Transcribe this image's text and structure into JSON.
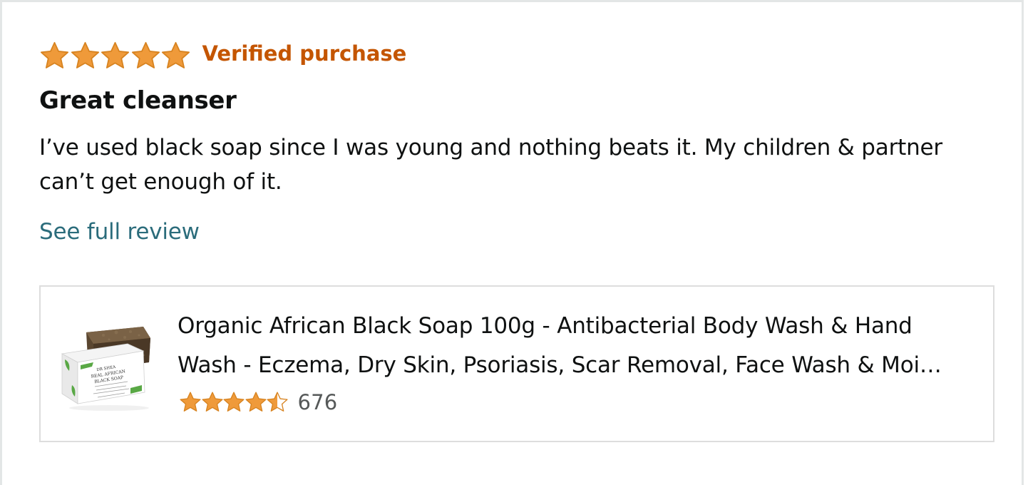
{
  "review": {
    "star_rating": 5,
    "max_stars": 5,
    "verified_label": "Verified purchase",
    "title": "Great cleanser",
    "body": "I’ve used black soap since I was young and nothing beats it. My children & partner can’t get enough of it.",
    "see_full_label": "See full review"
  },
  "product": {
    "title": "Organic African Black Soap 100g - Antibacterial Body Wash & Hand Wash - Eczema, Dry Skin, Psoriasis, Scar Removal, Face Wash & Moi…",
    "star_rating": 4.5,
    "max_stars": 5,
    "review_count": "676",
    "image_name": "black-soap-product-image",
    "box_label_lines": [
      "DR SHEA",
      "REAL AFRICAN",
      "BLACK SOAP"
    ]
  },
  "colors": {
    "star_fill": "#ef9a3a",
    "star_stroke": "#d78320",
    "verified": "#c45500",
    "link": "#2b6c7b",
    "text": "#0f1111",
    "muted": "#565959",
    "border": "#dddddd",
    "brand_green": "#59a845"
  },
  "icons": {
    "full_star": "star-full-icon",
    "half_star": "star-half-icon",
    "empty_star": "star-empty-icon"
  }
}
